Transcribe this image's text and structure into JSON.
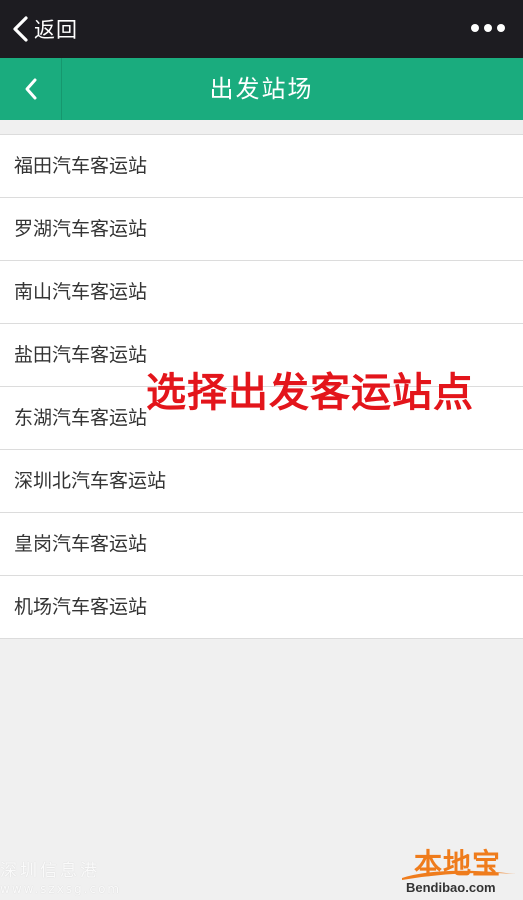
{
  "topbar": {
    "back_label": "返回"
  },
  "header": {
    "title": "出发站场"
  },
  "stations": [
    "福田汽车客运站",
    "罗湖汽车客运站",
    "南山汽车客运站",
    "盐田汽车客运站",
    "东湖汽车客运站",
    "深圳北汽车客运站",
    "皇岗汽车客运站",
    "机场汽车客运站"
  ],
  "overlay": {
    "text": "选择出发客运站点"
  },
  "watermark": {
    "left_text": "深圳信息港",
    "left_url": "www.szxsg.com",
    "logo_text": "本地宝",
    "logo_url": "Bendibao.com"
  },
  "colors": {
    "topbar": "#1d1c21",
    "header": "#1aac7e",
    "overlay": "#e3151b",
    "logo": "#ef7c1c"
  }
}
